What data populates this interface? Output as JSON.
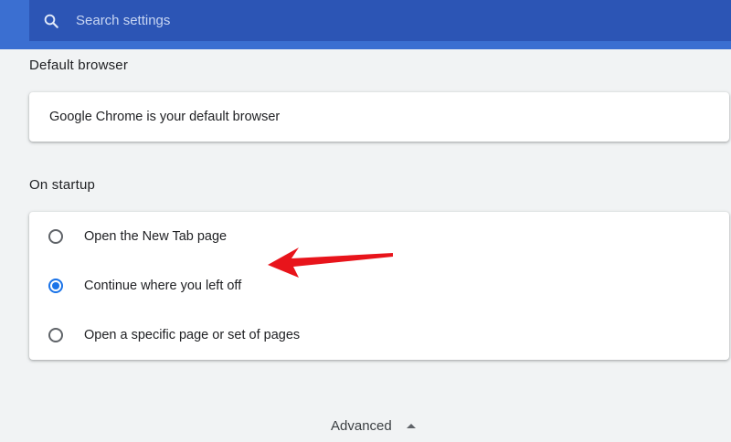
{
  "search": {
    "placeholder": "Search settings",
    "icon": "search-icon"
  },
  "default_browser": {
    "title": "Default browser",
    "status": "Google Chrome is your default browser"
  },
  "startup": {
    "title": "On startup",
    "options": [
      {
        "label": "Open the New Tab page",
        "selected": false
      },
      {
        "label": "Continue where you left off",
        "selected": true
      },
      {
        "label": "Open a specific page or set of pages",
        "selected": false
      }
    ]
  },
  "advanced": {
    "label": "Advanced",
    "icon": "arrow-up-icon"
  },
  "colors": {
    "header": "#3b6fd1",
    "search_bar": "#2c55b5",
    "accent": "#1a73e8",
    "annotation_arrow": "#e8141b"
  }
}
